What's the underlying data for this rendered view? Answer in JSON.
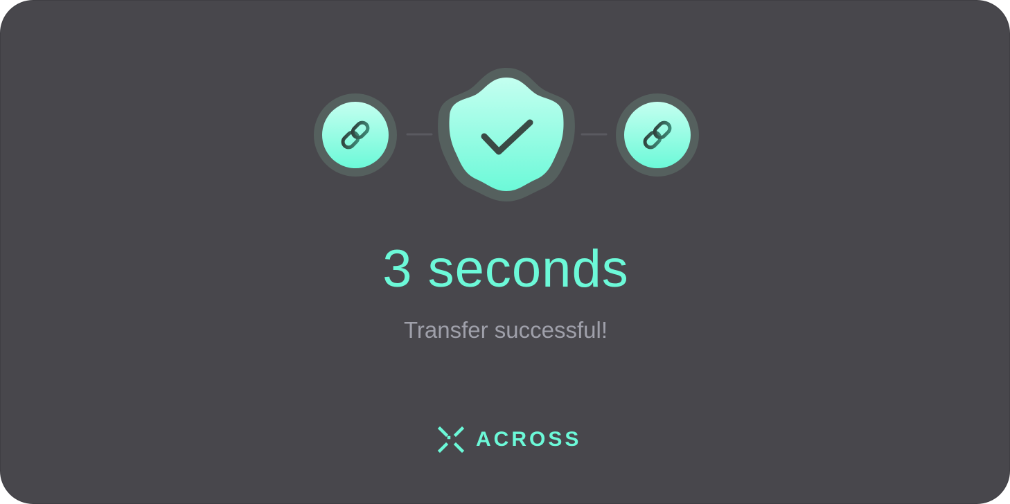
{
  "colors": {
    "card_background": "#48474c",
    "accent": "#6cf9d8",
    "accent_light": "#c4fff0",
    "subtitle": "#9fa0aa",
    "icon_dark": "#3a4a45",
    "halo": "#55605e",
    "connector": "#5a5a60"
  },
  "progress": {
    "source_icon": "chain-link-icon",
    "status_icon": "checkmark-badge-icon",
    "destination_icon": "chain-link-icon"
  },
  "result": {
    "duration": "3 seconds",
    "message": "Transfer successful!"
  },
  "brand": {
    "logo_icon": "across-x-logo-icon",
    "name": "ACROSS"
  }
}
